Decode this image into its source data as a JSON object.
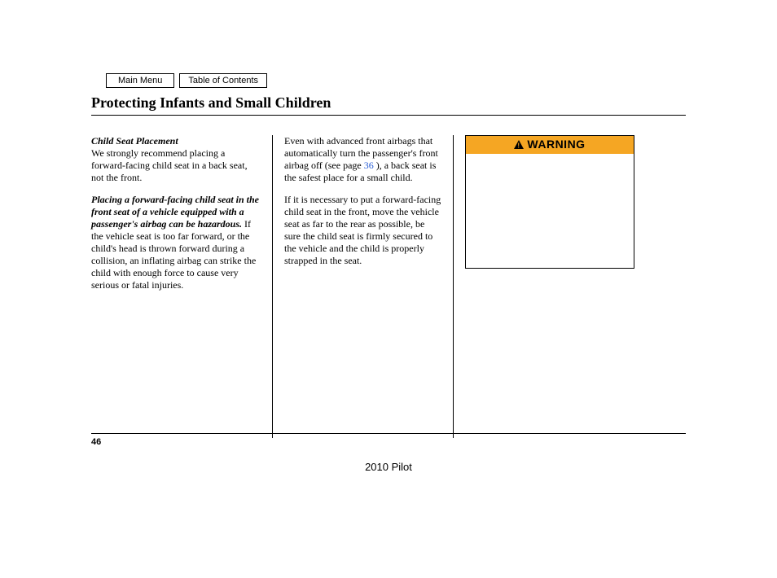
{
  "nav": {
    "main_menu": "Main Menu",
    "toc": "Table of Contents"
  },
  "title": "Protecting Infants and Small Children",
  "col1": {
    "subhead": "Child Seat Placement",
    "p1": "We strongly recommend placing a forward-facing child seat in a back seat, not the front.",
    "p2_bold": "Placing a forward-facing child seat in the front seat of a vehicle equipped with a passenger's airbag can be hazardous.",
    "p2_rest": " If the vehicle seat is too far forward, or the child's head is thrown forward during a collision, an inflating airbag can strike the child with enough force to cause very serious or fatal injuries."
  },
  "col2": {
    "p1a": "Even with advanced front airbags that automatically turn the passenger's front airbag off (see page ",
    "p1_link": "36",
    "p1b": " ), a back seat is the safest place for a small child.",
    "p2": "If it is necessary to put a forward-facing child seat in the front, move the vehicle seat as far to the rear as possible, be sure the child seat is firmly secured to the vehicle and the child is properly strapped in the seat."
  },
  "warning": {
    "label": "WARNING"
  },
  "page_number": "46",
  "footer": "2010 Pilot"
}
